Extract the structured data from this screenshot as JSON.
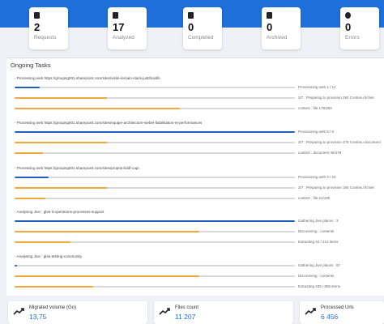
{
  "colors": {
    "accent": "#1e6fd9",
    "progress_blue": "#1f5fbf",
    "progress_orange": "#f2a93b"
  },
  "stats": [
    {
      "icon": "clipboard-icon",
      "value": "2",
      "label": "Requests"
    },
    {
      "icon": "chart-icon",
      "value": "17",
      "label": "Analyzed"
    },
    {
      "icon": "checkbox-icon",
      "value": "0",
      "label": "Completed"
    },
    {
      "icon": "archive-icon",
      "value": "0",
      "label": "Archived"
    },
    {
      "icon": "error-icon",
      "value": "0",
      "label": "Errors"
    }
  ],
  "tasks": {
    "title": "Ongoing Tasks",
    "items": [
      {
        "header": "- Processing web https://groupsg001.sharepoint.com/sites/visite-lemain-slack-justificatifs",
        "bars": [
          {
            "color": "blue",
            "progress": 0.09,
            "text": "Provisioning web 1 / 12"
          },
          {
            "color": "orange",
            "progress": 0.33,
            "text": "3/7 : Preparing to provision 292 Contenu fichier"
          },
          {
            "color": "orange",
            "progress": 0.59,
            "text": "content : file 175/292"
          }
        ]
      },
      {
        "header": "- Processing web https://groupsg001.sharepoint.com/sites/equipe-architecture-siebel-fiabilisation-et-performances",
        "bars": [
          {
            "color": "blue",
            "progress": 1.0,
            "text": "Provisioning web 8 / 8"
          },
          {
            "color": "orange",
            "progress": 0.33,
            "text": "3/7 : Preparing to provision 479 Contenu document"
          },
          {
            "color": "orange",
            "progress": 0.1,
            "text": "content : document 46/479"
          }
        ]
      },
      {
        "header": "- Processing web https://groupsg001.sharepoint.com/sites/projets-bddf-capi",
        "bars": [
          {
            "color": "blue",
            "progress": 0.12,
            "text": "Provisioning web 3 / 24"
          },
          {
            "color": "orange",
            "progress": 0.33,
            "text": "3/7 : Preparing to provision 190 Contenu fichier"
          },
          {
            "color": "orange",
            "progress": 0.11,
            "text": "content : file 21/190"
          }
        ]
      },
      {
        "header": "- Analysing Jive : gbis-it-operations-processes-support",
        "bars": [
          {
            "color": "blue",
            "progress": 1.0,
            "text": "Gathering Jive places : 3"
          },
          {
            "color": "orange",
            "progress": 0.66,
            "text": "Discovering : contents"
          },
          {
            "color": "orange",
            "progress": 0.2,
            "text": "Extracting 42 / 212 items"
          }
        ]
      },
      {
        "header": "- Analysing Jive : gbis-testing-community",
        "bars": [
          {
            "color": "blue",
            "progress": 0.01,
            "text": "Gathering Jive places : 97"
          },
          {
            "color": "orange",
            "progress": 0.66,
            "text": "Discovering : contents"
          },
          {
            "color": "orange",
            "progress": 0.28,
            "text": "Extracting 225 / 806 items"
          }
        ]
      }
    ]
  },
  "summary": [
    {
      "icon": "trending-up-icon",
      "label": "Migrated volume (Go)",
      "value": "13,75"
    },
    {
      "icon": "trending-up-icon",
      "label": "Files count",
      "value": "11 207"
    },
    {
      "icon": "trending-up-icon",
      "label": "Processed Urls",
      "value": "6 456"
    }
  ]
}
